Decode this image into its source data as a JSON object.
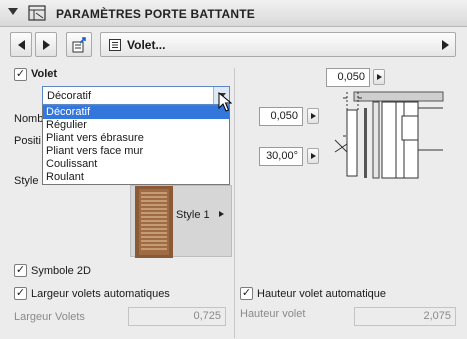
{
  "header": {
    "title": "PARAMÈTRES PORTE BATTANTE"
  },
  "nav": {
    "selected_label": "Volet..."
  },
  "volet": {
    "checkbox_label": "Volet",
    "checked": true
  },
  "left_labels": {
    "nombre": "Nomb",
    "position": "Positi",
    "style": "Style d"
  },
  "type_combo": {
    "value": "Décoratif",
    "options": [
      "Décoratif",
      "Régulier",
      "Pliant vers ébrasure",
      "Pliant vers face mur",
      "Coulissant",
      "Roulant"
    ],
    "selected_index": 0
  },
  "preview": {
    "style_label": "Style 1"
  },
  "symbole_2d": {
    "label": "Symbole 2D",
    "checked": true
  },
  "largeur_auto": {
    "label": "Largeur volets automatiques",
    "checked": true
  },
  "largeur_volets": {
    "label": "Largeur Volets",
    "value": "0,725"
  },
  "hauteur_auto": {
    "label": "Hauteur volet automatique",
    "checked": true
  },
  "hauteur_volet": {
    "label": "Hauteur volet",
    "value": "2,075"
  },
  "dimensions": {
    "top": "0,050",
    "left": "0,050",
    "angle": "30,00°"
  },
  "colors": {
    "selection": "#3377dd",
    "shutter_wood": "#8a5a36",
    "shutter_slat": "#c9a47e"
  }
}
